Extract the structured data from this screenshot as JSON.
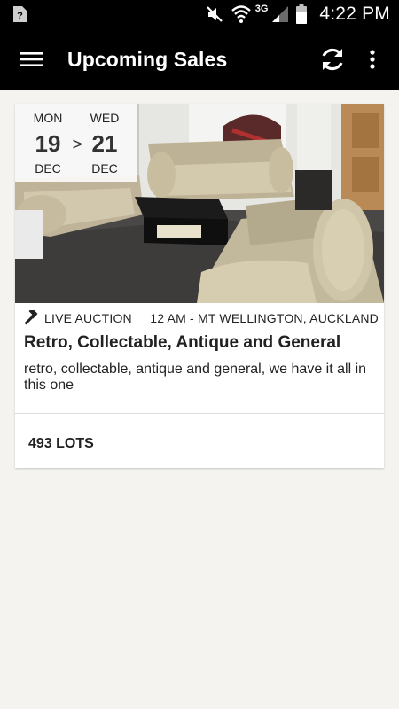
{
  "status_bar": {
    "time": "4:22 PM",
    "network": "3G",
    "icons": [
      "notification-icon",
      "mute-icon",
      "wifi-icon",
      "signal-icon",
      "battery-icon"
    ]
  },
  "app_bar": {
    "title": "Upcoming Sales",
    "icons": [
      "menu-icon",
      "refresh-icon",
      "overflow-icon"
    ]
  },
  "sales": [
    {
      "start": {
        "day_name": "MON",
        "day": "19",
        "month": "DEC"
      },
      "end": {
        "day_name": "WED",
        "day": "21",
        "month": "DEC"
      },
      "separator": ">",
      "type": "LIVE AUCTION",
      "time_location": "12 AM - MT WELLINGTON, AUCKLAND",
      "title": "Retro, Collectable, Antique and General",
      "description": "retro, collectable, antique and general, we have it all in this one",
      "lots": "493 LOTS"
    }
  ],
  "colors": {
    "app_bar_bg": "#000000",
    "page_bg": "#f4f3f0",
    "card_bg": "#ffffff",
    "text": "#222222"
  }
}
